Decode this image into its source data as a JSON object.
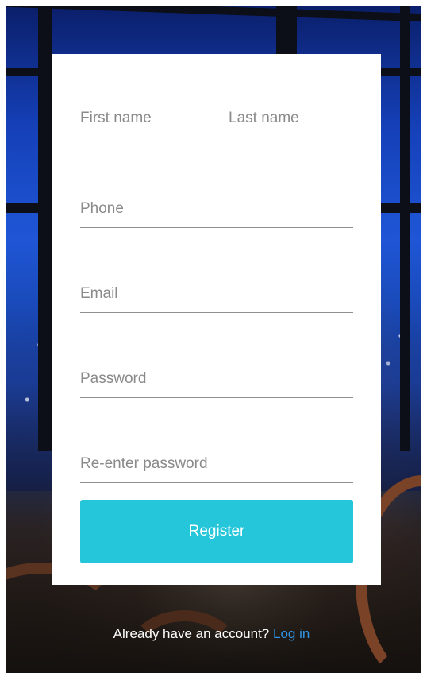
{
  "form": {
    "first_name": {
      "value": "",
      "placeholder": "First name"
    },
    "last_name": {
      "value": "",
      "placeholder": "Last name"
    },
    "phone": {
      "value": "",
      "placeholder": "Phone"
    },
    "email": {
      "value": "",
      "placeholder": "Email"
    },
    "password": {
      "value": "",
      "placeholder": "Password"
    },
    "reenter_password": {
      "value": "",
      "placeholder": "Re-enter password"
    },
    "register_label": "Register"
  },
  "footer": {
    "prompt": "Already have an account?",
    "login_label": "Log in"
  },
  "colors": {
    "accent": "#26c6da",
    "link": "#2f95e6",
    "card": "#ffffff"
  }
}
